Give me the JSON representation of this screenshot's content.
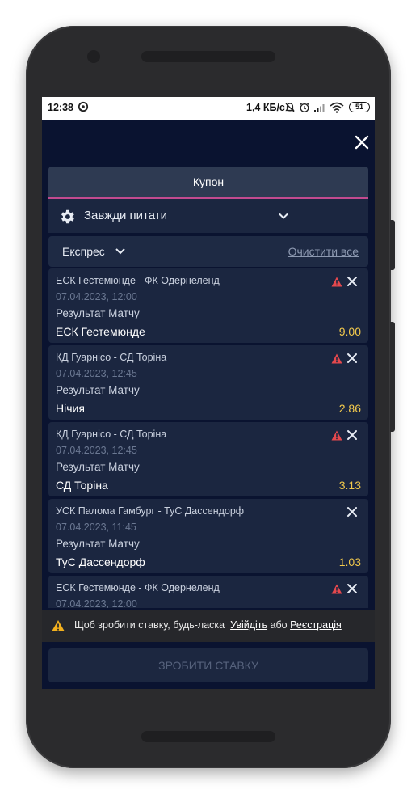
{
  "status_bar": {
    "time": "12:38",
    "speed": "1,4 КБ/с",
    "battery": "51",
    "icons": [
      "whatsapp-icon",
      "notifications-off-icon",
      "alarm-icon",
      "signal-icon",
      "wifi-icon",
      "battery-icon"
    ]
  },
  "header": {
    "tab_label": "Купон",
    "close_icon": "close-icon"
  },
  "accept_setting": {
    "label": "Завжди питати",
    "icon": "gear-icon"
  },
  "bet_type": {
    "label": "Експрес",
    "clear_label": "Очистити все"
  },
  "bets": [
    {
      "event": "ЕСК Гестемюнде - ФК Одернеленд",
      "date": "07.04.2023, 12:00",
      "market": "Результат Матчу",
      "selection": "ЕСК Гестемюнде",
      "odds": "9.00",
      "warning": true
    },
    {
      "event": "КД Гуарнісо - СД Торіна",
      "date": "07.04.2023, 12:45",
      "market": "Результат Матчу",
      "selection": "Нічия",
      "odds": "2.86",
      "warning": true
    },
    {
      "event": "КД Гуарнісо - СД Торіна",
      "date": "07.04.2023, 12:45",
      "market": "Результат Матчу",
      "selection": "СД Торіна",
      "odds": "3.13",
      "warning": true
    },
    {
      "event": "УСК Палома Гамбург - ТуС Дассендорф",
      "date": "07.04.2023, 11:45",
      "market": "Результат Матчу",
      "selection": "ТуС Дассендорф",
      "odds": "1.03",
      "warning": false
    },
    {
      "event": "ЕСК Гестемюнде - ФК Одернеленд",
      "date": "07.04.2023, 12:00",
      "market": "",
      "selection": "",
      "odds": "",
      "warning": true
    }
  ],
  "notice": {
    "text": "Щоб зробити ставку, будь-ласка",
    "login": "Увійдіть",
    "or": "або",
    "register": "Реєстрація"
  },
  "place_bet_label": "ЗРОБИТИ СТАВКУ",
  "colors": {
    "background": "#0a1330",
    "panel": "#1b2640",
    "odds": "#f2c94c",
    "accent_underline": "#c24a8f",
    "warning_red": "#e5484d",
    "warning_yellow": "#f2b01e"
  }
}
